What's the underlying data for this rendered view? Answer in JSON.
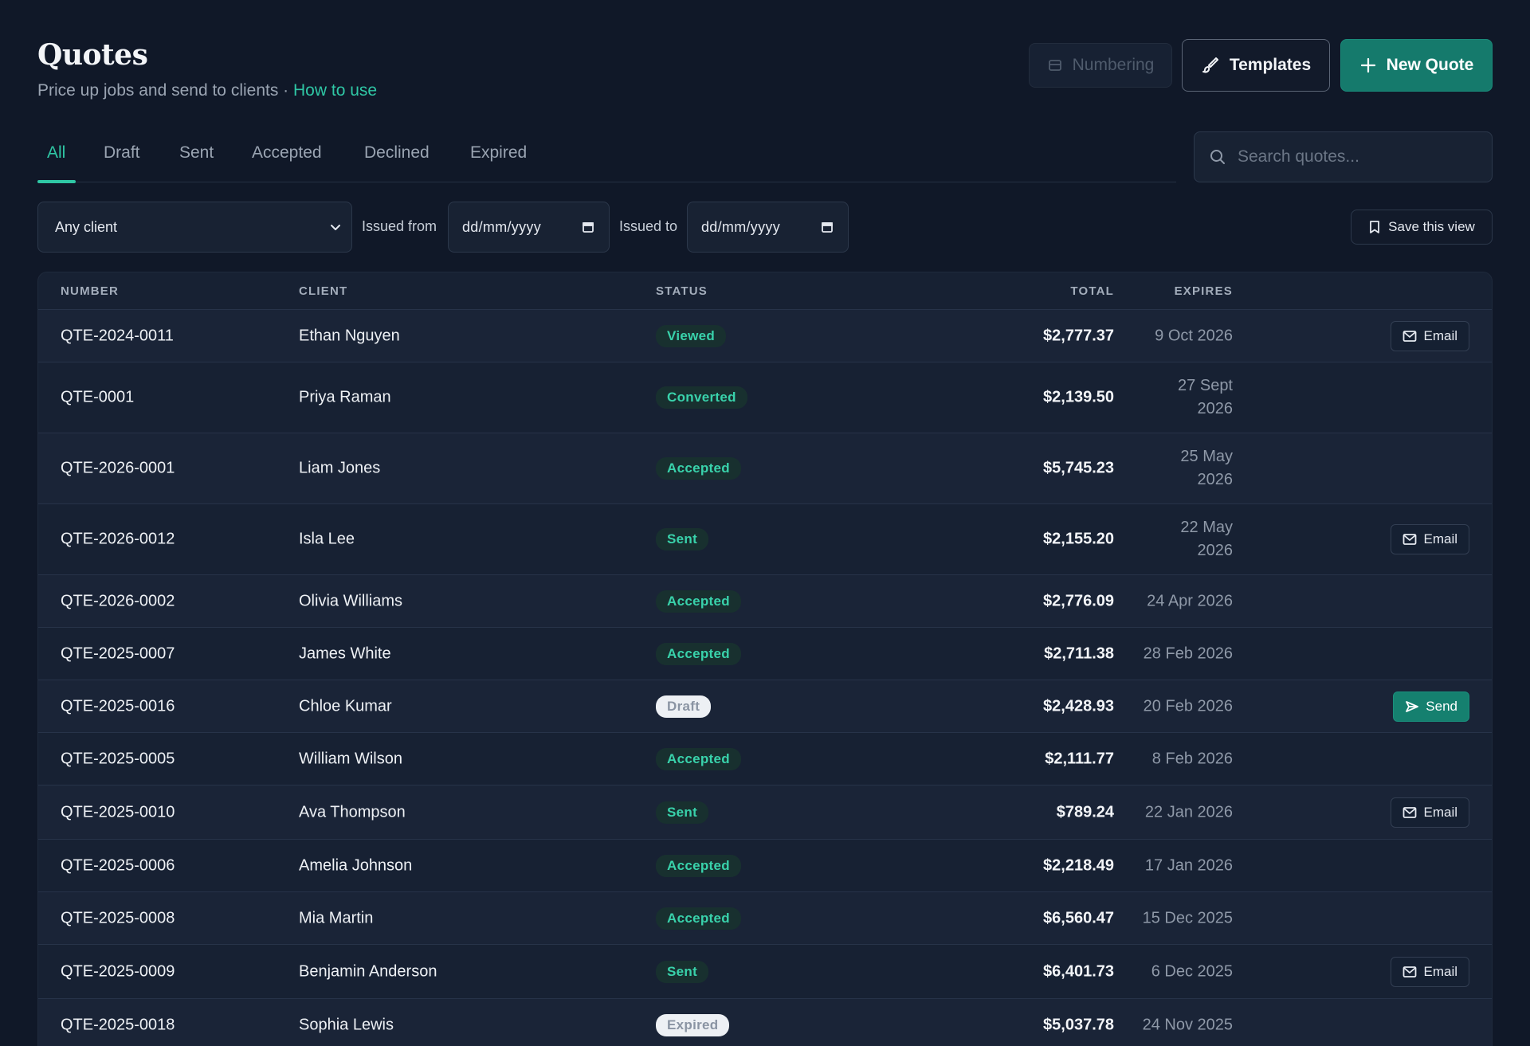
{
  "header": {
    "title": "Quotes",
    "subtitle_text": "Price up jobs and send to clients · ",
    "subtitle_link": "How to use",
    "buttons": {
      "numbering": "Numbering",
      "templates": "Templates",
      "new_quote": "New Quote"
    }
  },
  "tabs": [
    {
      "label": "All",
      "active": true
    },
    {
      "label": "Draft",
      "active": false
    },
    {
      "label": "Sent",
      "active": false
    },
    {
      "label": "Accepted",
      "active": false
    },
    {
      "label": "Declined",
      "active": false
    },
    {
      "label": "Expired",
      "active": false
    }
  ],
  "search": {
    "placeholder": "Search quotes..."
  },
  "filters": {
    "client_select": "Any client",
    "issued_from_label": "Issued from",
    "issued_from_value": "dd/mm/yyyy",
    "issued_to_label": "Issued to",
    "issued_to_value": "dd/mm/yyyy",
    "save_view": "Save this view"
  },
  "table": {
    "columns": {
      "number": "NUMBER",
      "client": "CLIENT",
      "status": "STATUS",
      "total": "TOTAL",
      "expires": "EXPIRES"
    },
    "rows": [
      {
        "number": "QTE-2024-0011",
        "client": "Ethan Nguyen",
        "status": "Viewed",
        "status_style": "green",
        "total": "$2,777.37",
        "expires": "9 Oct 2026",
        "action": "Email"
      },
      {
        "number": "QTE-0001",
        "client": "Priya Raman",
        "status": "Converted",
        "status_style": "green",
        "total": "$2,139.50",
        "expires": "27 Sept\n2026",
        "action": ""
      },
      {
        "number": "QTE-2026-0001",
        "client": "Liam Jones",
        "status": "Accepted",
        "status_style": "green",
        "total": "$5,745.23",
        "expires": "25 May\n2026",
        "action": ""
      },
      {
        "number": "QTE-2026-0012",
        "client": "Isla Lee",
        "status": "Sent",
        "status_style": "green",
        "total": "$2,155.20",
        "expires": "22 May\n2026",
        "action": "Email"
      },
      {
        "number": "QTE-2026-0002",
        "client": "Olivia Williams",
        "status": "Accepted",
        "status_style": "green",
        "total": "$2,776.09",
        "expires": "24 Apr 2026",
        "action": ""
      },
      {
        "number": "QTE-2025-0007",
        "client": "James White",
        "status": "Accepted",
        "status_style": "green",
        "total": "$2,711.38",
        "expires": "28 Feb 2026",
        "action": ""
      },
      {
        "number": "QTE-2025-0016",
        "client": "Chloe Kumar",
        "status": "Draft",
        "status_style": "grey",
        "total": "$2,428.93",
        "expires": "20 Feb 2026",
        "action": "Send"
      },
      {
        "number": "QTE-2025-0005",
        "client": "William Wilson",
        "status": "Accepted",
        "status_style": "green",
        "total": "$2,111.77",
        "expires": "8 Feb 2026",
        "action": ""
      },
      {
        "number": "QTE-2025-0010",
        "client": "Ava Thompson",
        "status": "Sent",
        "status_style": "green",
        "total": "$789.24",
        "expires": "22 Jan 2026",
        "action": "Email"
      },
      {
        "number": "QTE-2025-0006",
        "client": "Amelia Johnson",
        "status": "Accepted",
        "status_style": "green",
        "total": "$2,218.49",
        "expires": "17 Jan 2026",
        "action": ""
      },
      {
        "number": "QTE-2025-0008",
        "client": "Mia Martin",
        "status": "Accepted",
        "status_style": "green",
        "total": "$6,560.47",
        "expires": "15 Dec 2025",
        "action": ""
      },
      {
        "number": "QTE-2025-0009",
        "client": "Benjamin Anderson",
        "status": "Sent",
        "status_style": "green",
        "total": "$6,401.73",
        "expires": "6 Dec 2025",
        "action": "Email"
      },
      {
        "number": "QTE-2025-0018",
        "client": "Sophia Lewis",
        "status": "Expired",
        "status_style": "grey",
        "total": "$5,037.78",
        "expires": "24 Nov 2025",
        "action": ""
      }
    ]
  },
  "colors": {
    "background": "#101828",
    "accent": "#2fc7a5",
    "primary_button": "#157a6c",
    "badge_green_text": "#39d2ab",
    "badge_grey_bg": "#edf0f4"
  }
}
